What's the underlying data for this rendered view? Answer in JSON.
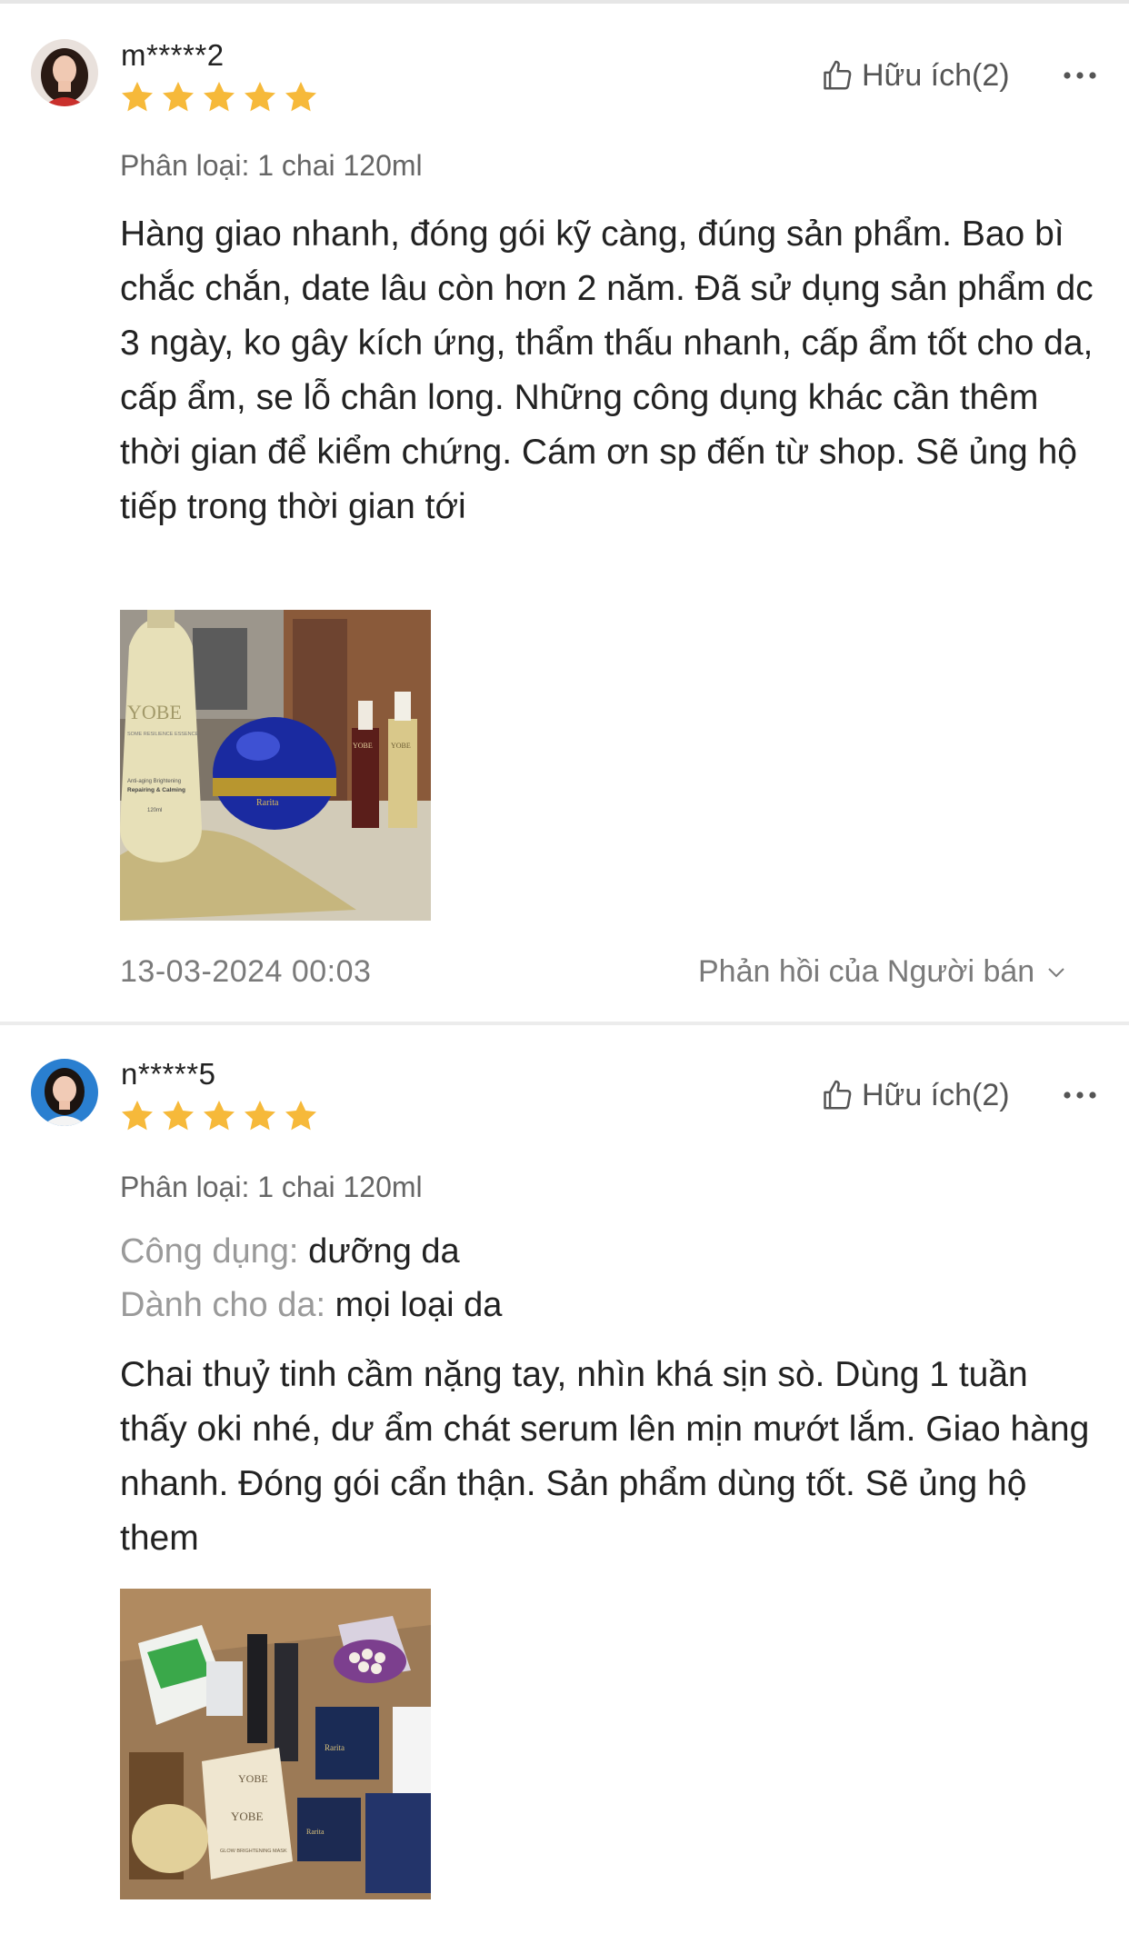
{
  "reviews": [
    {
      "username": "m*****2",
      "rating": 5,
      "helpful_label": "Hữu ích(2)",
      "variant": "Phân loại: 1 chai 120ml",
      "body": "Hàng giao nhanh, đóng gói kỹ càng, đúng sản phẩm. Bao bì chắc chắn, date lâu còn hơn 2 năm. Đã sử dụng sản phẩm dc 3 ngày, ko gây kích ứng, thẩm thấu nhanh, cấp ẩm tốt cho da, cấp ẩm, se lỗ chân long. Những công dụng khác cần thêm thời gian để kiểm chứng. Cám ơn sp đến từ shop. Sẽ ủng hộ tiếp trong thời gian tới",
      "photo_labels": {
        "bottle_brand": "YOBE",
        "bottle_line": "SOME RESILIENCE ESSENCE",
        "bottle_claims": "Anti-aging Brightening",
        "bottle_claim_bold": "Repairing & Calming",
        "bottle_volume": "120ml",
        "jar_brand": "Rarita",
        "vial_brand_1": "YOBE",
        "vial_brand_2": "YOBE"
      },
      "date": "13-03-2024 00:03",
      "seller_reply_label": "Phản hồi của Người bán"
    },
    {
      "username": "n*****5",
      "rating": 5,
      "helpful_label": "Hữu ích(2)",
      "variant": "Phân loại: 1 chai 120ml",
      "attributes": [
        {
          "label": "Công dụng:",
          "value": "dưỡng da"
        },
        {
          "label": "Dành cho da:",
          "value": "mọi loại da"
        }
      ],
      "body": "Chai thuỷ tinh cầm nặng tay, nhìn khá sịn sò. Dùng 1 tuần thấy oki nhé, dư ẩm chát serum lên mịn mướt lắm. Giao hàng nhanh. Đóng gói cẩn thận. Sản phẩm dùng tốt. Sẽ ủng hộ them",
      "photo_labels": {
        "mask_brand": "YOBE",
        "pouch_brand": "YOBE",
        "pouch_text": "GLOW BRIGHTENING MASK",
        "box_brand": "Rarita",
        "box_brand_2": "Rarita"
      }
    }
  ],
  "colors": {
    "star": "#f6b93a",
    "text_primary": "#222222",
    "text_secondary": "#7a7a7a",
    "attr_label": "#9a9a9a",
    "divider": "#ececec"
  },
  "icons": {
    "helpful": "thumbs-up-icon",
    "more": "more-dots-icon",
    "seller_reply": "chevron-down-icon",
    "star": "star-icon"
  }
}
